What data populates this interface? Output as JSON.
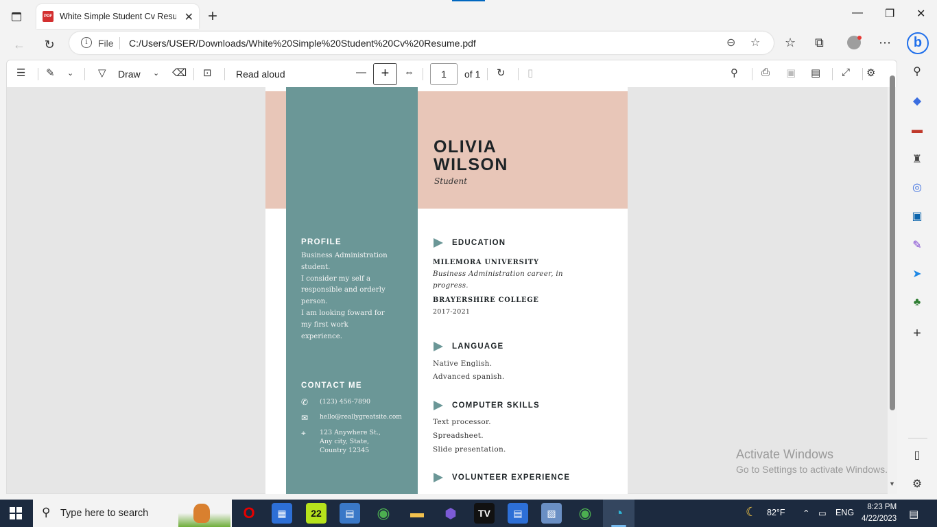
{
  "browser": {
    "tab_title": "White Simple Student Cv Resume.pdf",
    "tab_icon": "pdf-icon",
    "address_scheme_label": "File",
    "url": "C:/Users/USER/Downloads/White%20Simple%20Student%20Cv%20Resume.pdf"
  },
  "pdf_toolbar": {
    "draw_label": "Draw",
    "read_aloud_label": "Read aloud",
    "page_current": "1",
    "page_total": "of 1"
  },
  "resume": {
    "first_name": "OLIVIA",
    "last_name": "WILSON",
    "role": "Student",
    "colors": {
      "peach": "#e8c6b8",
      "teal": "#6b9797"
    },
    "profile": {
      "heading": "PROFILE",
      "lines": [
        "Business Administration",
        "student.",
        "I consider my self a",
        "responsible and orderly",
        "person.",
        "I am looking foward for",
        "my first work",
        "experience."
      ]
    },
    "contact": {
      "heading": "CONTACT ME",
      "phone": "(123) 456-7890",
      "email": "hello@reallygreatsite.com",
      "address_lines": [
        "123 Anywhere St.,",
        "Any city, State,",
        "Country 12345"
      ]
    },
    "education": {
      "heading": "EDUCATION",
      "school1": "MILEMORA UNIVERSITY",
      "school1_desc": "Business Administration career, in progress.",
      "school2": "BRAYERSHIRE COLLEGE",
      "school2_years": "2017-2021"
    },
    "language": {
      "heading": "LANGUAGE",
      "items": [
        "Native English.",
        "Advanced spanish."
      ]
    },
    "skills": {
      "heading": "COMPUTER SKILLS",
      "items": [
        "Text processor.",
        "Spreadsheet.",
        "Slide presentation."
      ]
    },
    "volunteer": {
      "heading": "VOLUNTEER EXPERIENCE"
    }
  },
  "watermark": {
    "title": "Activate Windows",
    "subtitle": "Go to Settings to activate Windows."
  },
  "taskbar": {
    "search_placeholder": "Type here to search",
    "temperature": "82°F",
    "language": "ENG",
    "time": "8:23 PM",
    "date": "4/22/2023",
    "badge_22": "22"
  }
}
